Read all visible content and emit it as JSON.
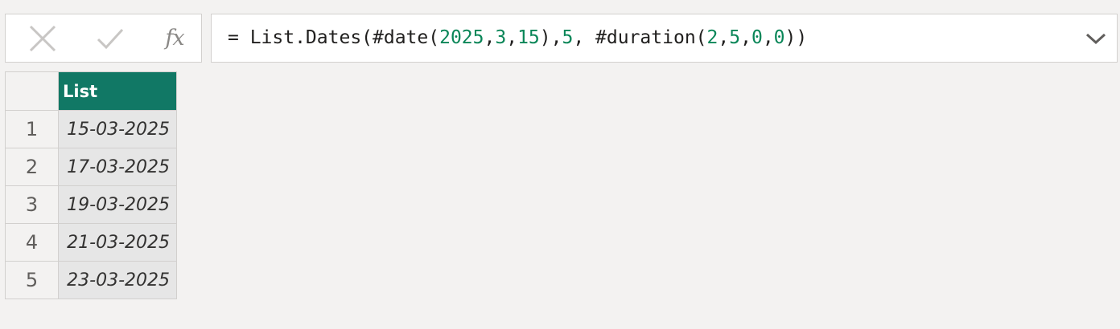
{
  "formula_bar": {
    "cancel_icon": "close-x-icon",
    "commit_icon": "checkmark-icon",
    "fx_label": "fx",
    "formula_segments": [
      {
        "text": "= List.Dates(#date(",
        "kind": "plain"
      },
      {
        "text": "2025",
        "kind": "num"
      },
      {
        "text": ",",
        "kind": "plain"
      },
      {
        "text": "3",
        "kind": "num"
      },
      {
        "text": ",",
        "kind": "plain"
      },
      {
        "text": "15",
        "kind": "num"
      },
      {
        "text": "),",
        "kind": "plain"
      },
      {
        "text": "5",
        "kind": "num"
      },
      {
        "text": ", #duration(",
        "kind": "plain"
      },
      {
        "text": "2",
        "kind": "num"
      },
      {
        "text": ",",
        "kind": "plain"
      },
      {
        "text": "5",
        "kind": "num"
      },
      {
        "text": ",",
        "kind": "plain"
      },
      {
        "text": "0",
        "kind": "num"
      },
      {
        "text": ",",
        "kind": "plain"
      },
      {
        "text": "0",
        "kind": "num"
      },
      {
        "text": "))",
        "kind": "plain"
      }
    ],
    "expand_icon": "chevron-down-icon"
  },
  "grid": {
    "column_header": "List",
    "rows": [
      {
        "num": "1",
        "value": "15-03-2025"
      },
      {
        "num": "2",
        "value": "17-03-2025"
      },
      {
        "num": "3",
        "value": "19-03-2025"
      },
      {
        "num": "4",
        "value": "21-03-2025"
      },
      {
        "num": "5",
        "value": "23-03-2025"
      }
    ]
  },
  "colors": {
    "header_bg": "#117865",
    "number_literal": "#098658",
    "page_bg": "#f3f2f1",
    "cell_bg": "#e6e6e6"
  }
}
